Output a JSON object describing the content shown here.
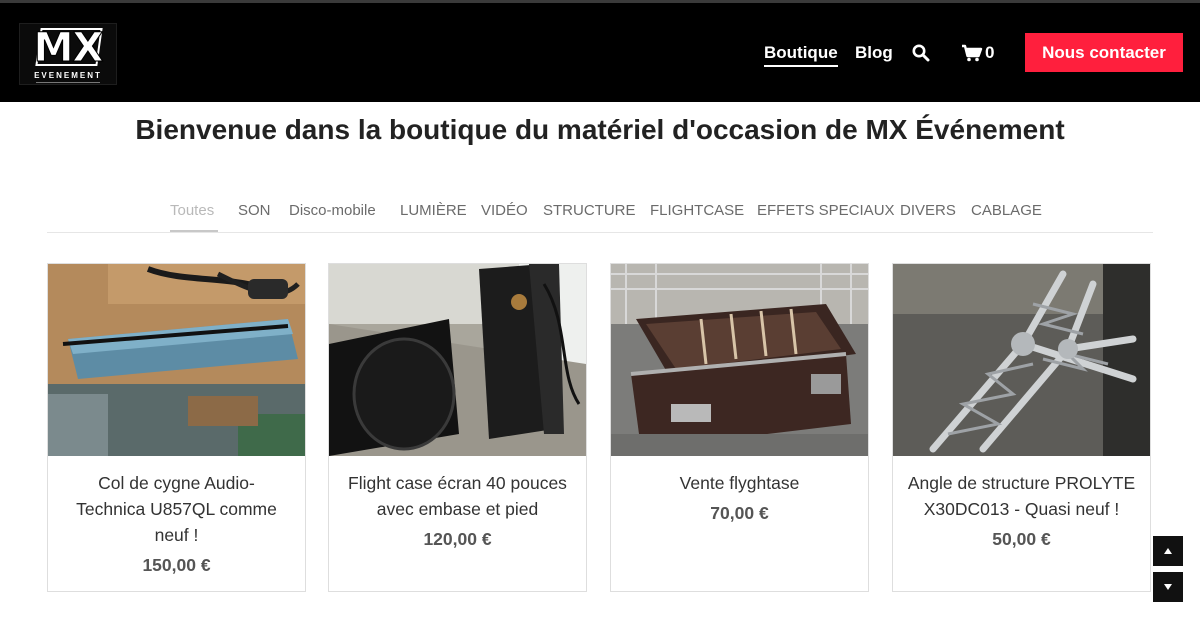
{
  "header": {
    "logo_text": "MX",
    "logo_subtext": "EVENEMENT",
    "nav": {
      "boutique": "Boutique",
      "blog": "Blog",
      "cart_count": "0",
      "contact": "Nous contacter"
    },
    "icons": {
      "search": "search-icon",
      "cart": "cart-icon"
    },
    "contact_color": "#ff1f3d"
  },
  "page": {
    "title": "Bienvenue dans la boutique du matériel d'occasion de MX Événement"
  },
  "filters": [
    {
      "label": "Toutes",
      "active": true
    },
    {
      "label": "SON"
    },
    {
      "label": "Disco-mobile"
    },
    {
      "label": "LUMIÈRE"
    },
    {
      "label": "VIDÉO"
    },
    {
      "label": "STRUCTURE"
    },
    {
      "label": "FLIGHTCASE"
    },
    {
      "label": "EFFETS SPECIAUX"
    },
    {
      "label": "DIVERS"
    },
    {
      "label": "CABLAGE"
    }
  ],
  "products": [
    {
      "title_lines": [
        "Col de cygne Audio-",
        "Technica U857QL comme",
        "neuf !"
      ],
      "price": "150,00 €"
    },
    {
      "title_lines": [
        "Flight case écran 40 pouces",
        "avec embase et pied"
      ],
      "price": "120,00 €"
    },
    {
      "title_lines": [
        "Vente flyghtase"
      ],
      "price": "70,00 €"
    },
    {
      "title_lines": [
        "Angle de structure PROLYTE",
        "X30DC013 - Quasi neuf !"
      ],
      "price": "50,00 €"
    }
  ],
  "scroll": {
    "up_icon": "arrow-up-icon",
    "down_icon": "arrow-down-icon"
  }
}
